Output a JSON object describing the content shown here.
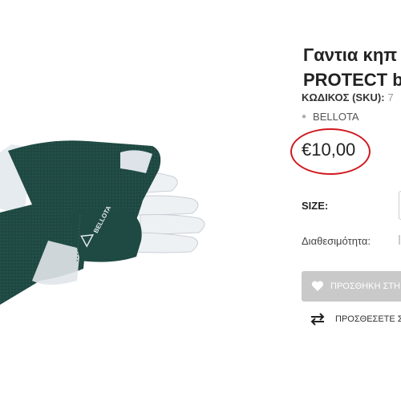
{
  "product": {
    "title_line1": "Γαντια κηπ",
    "title_line2": "PROTECT be",
    "sku_label": "ΚΩΔΙΚΟΣ (SKU):",
    "sku_value": "7",
    "brand": "BELLOTA",
    "price": "€10,00",
    "glove_logo_text": "BELLOTA"
  },
  "options": {
    "size_label": "SIZE:",
    "availability_label": "Διαθεσιμότητα:"
  },
  "actions": {
    "add_to_cart_label": "ΠΡΟΣΘΗΚΗ ΣΤΗ ΛΙ",
    "compare_label": "ΠΡΟΣΘΕΣΕΤΕ Σ"
  },
  "colors": {
    "glove_green": "#1f4a43",
    "glove_leather": "#e9edf1",
    "price_circle": "#d0191f",
    "button_bg": "#c9c9c9"
  },
  "icons": {
    "add_to_cart": "heart-icon",
    "compare": "swap-arrows-icon"
  }
}
